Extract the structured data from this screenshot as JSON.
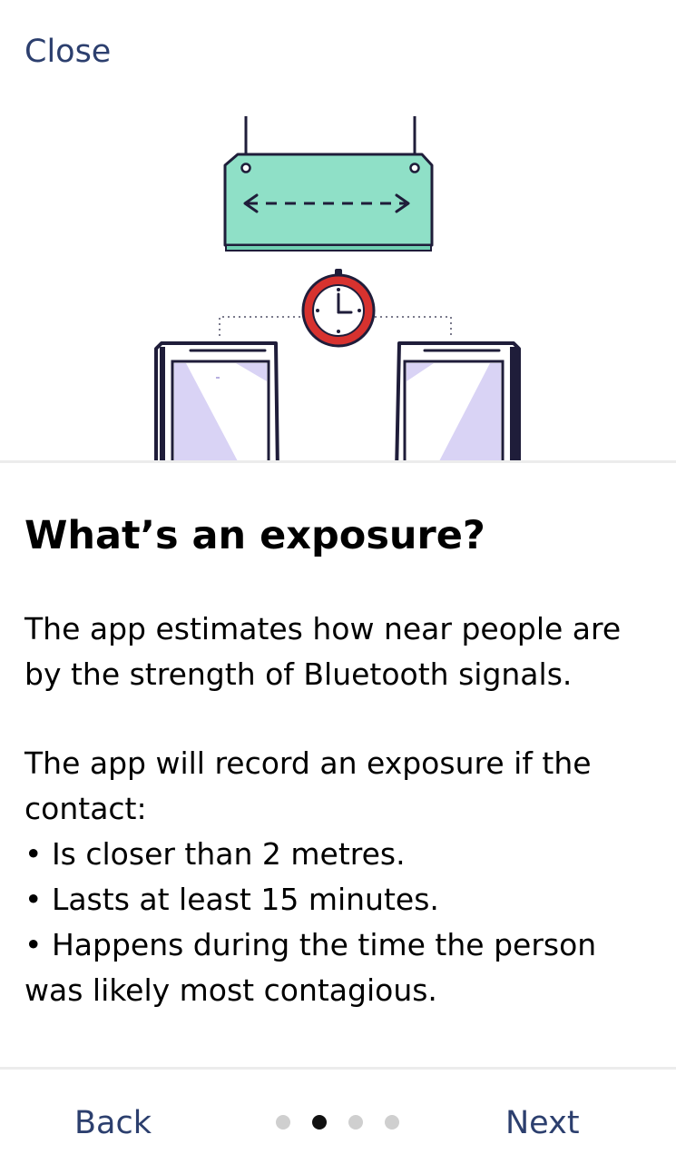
{
  "header": {
    "close_label": "Close"
  },
  "content": {
    "title": "What’s an exposure?",
    "paragraph_1_line_1": "The app estimates how near people are",
    "paragraph_1_line_2": "by the strength of Bluetooth signals.",
    "paragraph_2_line_1": "The app will record an exposure if the",
    "paragraph_2_line_2": "contact:",
    "bullets": [
      "• Is closer than 2 metres.",
      "• Lasts at least 15 minutes.",
      "• Happens during the time the person",
      "was likely most contagious."
    ]
  },
  "footer": {
    "back_label": "Back",
    "next_label": "Next",
    "page_count": 4,
    "current_page": 2
  },
  "colors": {
    "link": "#2c3f6e",
    "sign_fill": "#8fe0c7",
    "clock_ring": "#d7322f",
    "phone_screen": "#d9d3f5",
    "outline": "#1f1d3a"
  },
  "icons": {
    "illustration": "hanging-distance-sign-with-clock-and-two-phones-illustration"
  }
}
